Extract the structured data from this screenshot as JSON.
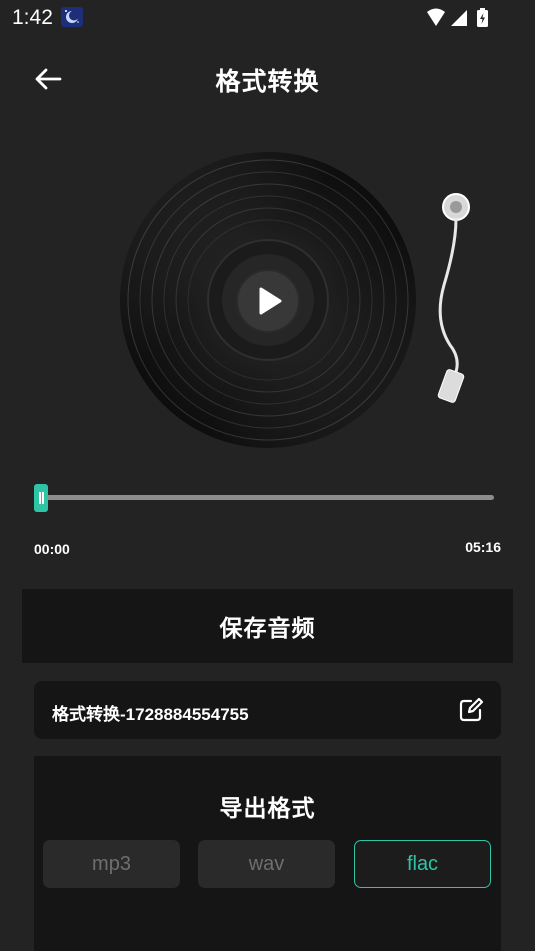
{
  "status_bar": {
    "time": "1:42"
  },
  "app_bar": {
    "title": "格式转换"
  },
  "player": {
    "progress": 0.0,
    "current_time": "00:00",
    "total_time": "05:16"
  },
  "save_audio": {
    "label": "保存音频"
  },
  "filename": {
    "value": "格式转换-1728884554755"
  },
  "export": {
    "title": "导出格式",
    "formats": [
      {
        "label": "mp3",
        "selected": false
      },
      {
        "label": "wav",
        "selected": false
      },
      {
        "label": "flac",
        "selected": true
      }
    ]
  },
  "colors": {
    "accent": "#2ec4a6",
    "background": "#232323",
    "panel": "#151515"
  }
}
